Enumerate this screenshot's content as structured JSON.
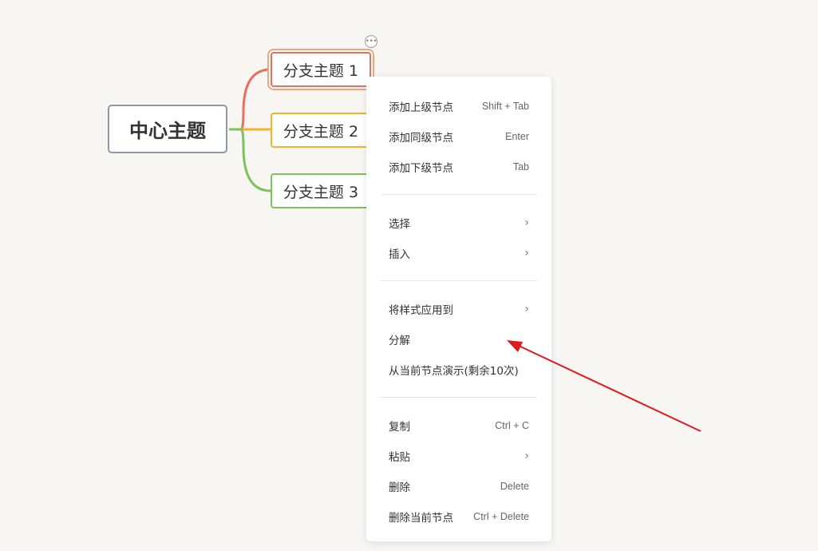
{
  "mindmap": {
    "center_label": "中心主题",
    "branches": [
      {
        "label": "分支主题 1",
        "color": "#e86f5c"
      },
      {
        "label": "分支主题 2",
        "color": "#f3b32b"
      },
      {
        "label": "分支主题 3",
        "color": "#7bc35a"
      }
    ],
    "more_icon": "ellipsis-icon",
    "more_glyph": "•••"
  },
  "context_menu": {
    "groups": [
      [
        {
          "label": "添加上级节点",
          "shortcut": "Shift + Tab"
        },
        {
          "label": "添加同级节点",
          "shortcut": "Enter"
        },
        {
          "label": "添加下级节点",
          "shortcut": "Tab"
        }
      ],
      [
        {
          "label": "选择",
          "submenu": true
        },
        {
          "label": "插入",
          "submenu": true
        }
      ],
      [
        {
          "label": "将样式应用到",
          "submenu": true
        },
        {
          "label": "分解"
        },
        {
          "label": "从当前节点演示(剩余10次)"
        }
      ],
      [
        {
          "label": "复制",
          "shortcut": "Ctrl + C"
        },
        {
          "label": "粘贴",
          "submenu": true
        },
        {
          "label": "删除",
          "shortcut": "Delete"
        },
        {
          "label": "删除当前节点",
          "shortcut": "Ctrl + Delete"
        }
      ]
    ],
    "chevron_glyph": "›"
  },
  "annotation": {
    "arrow_color": "#e0191d"
  }
}
